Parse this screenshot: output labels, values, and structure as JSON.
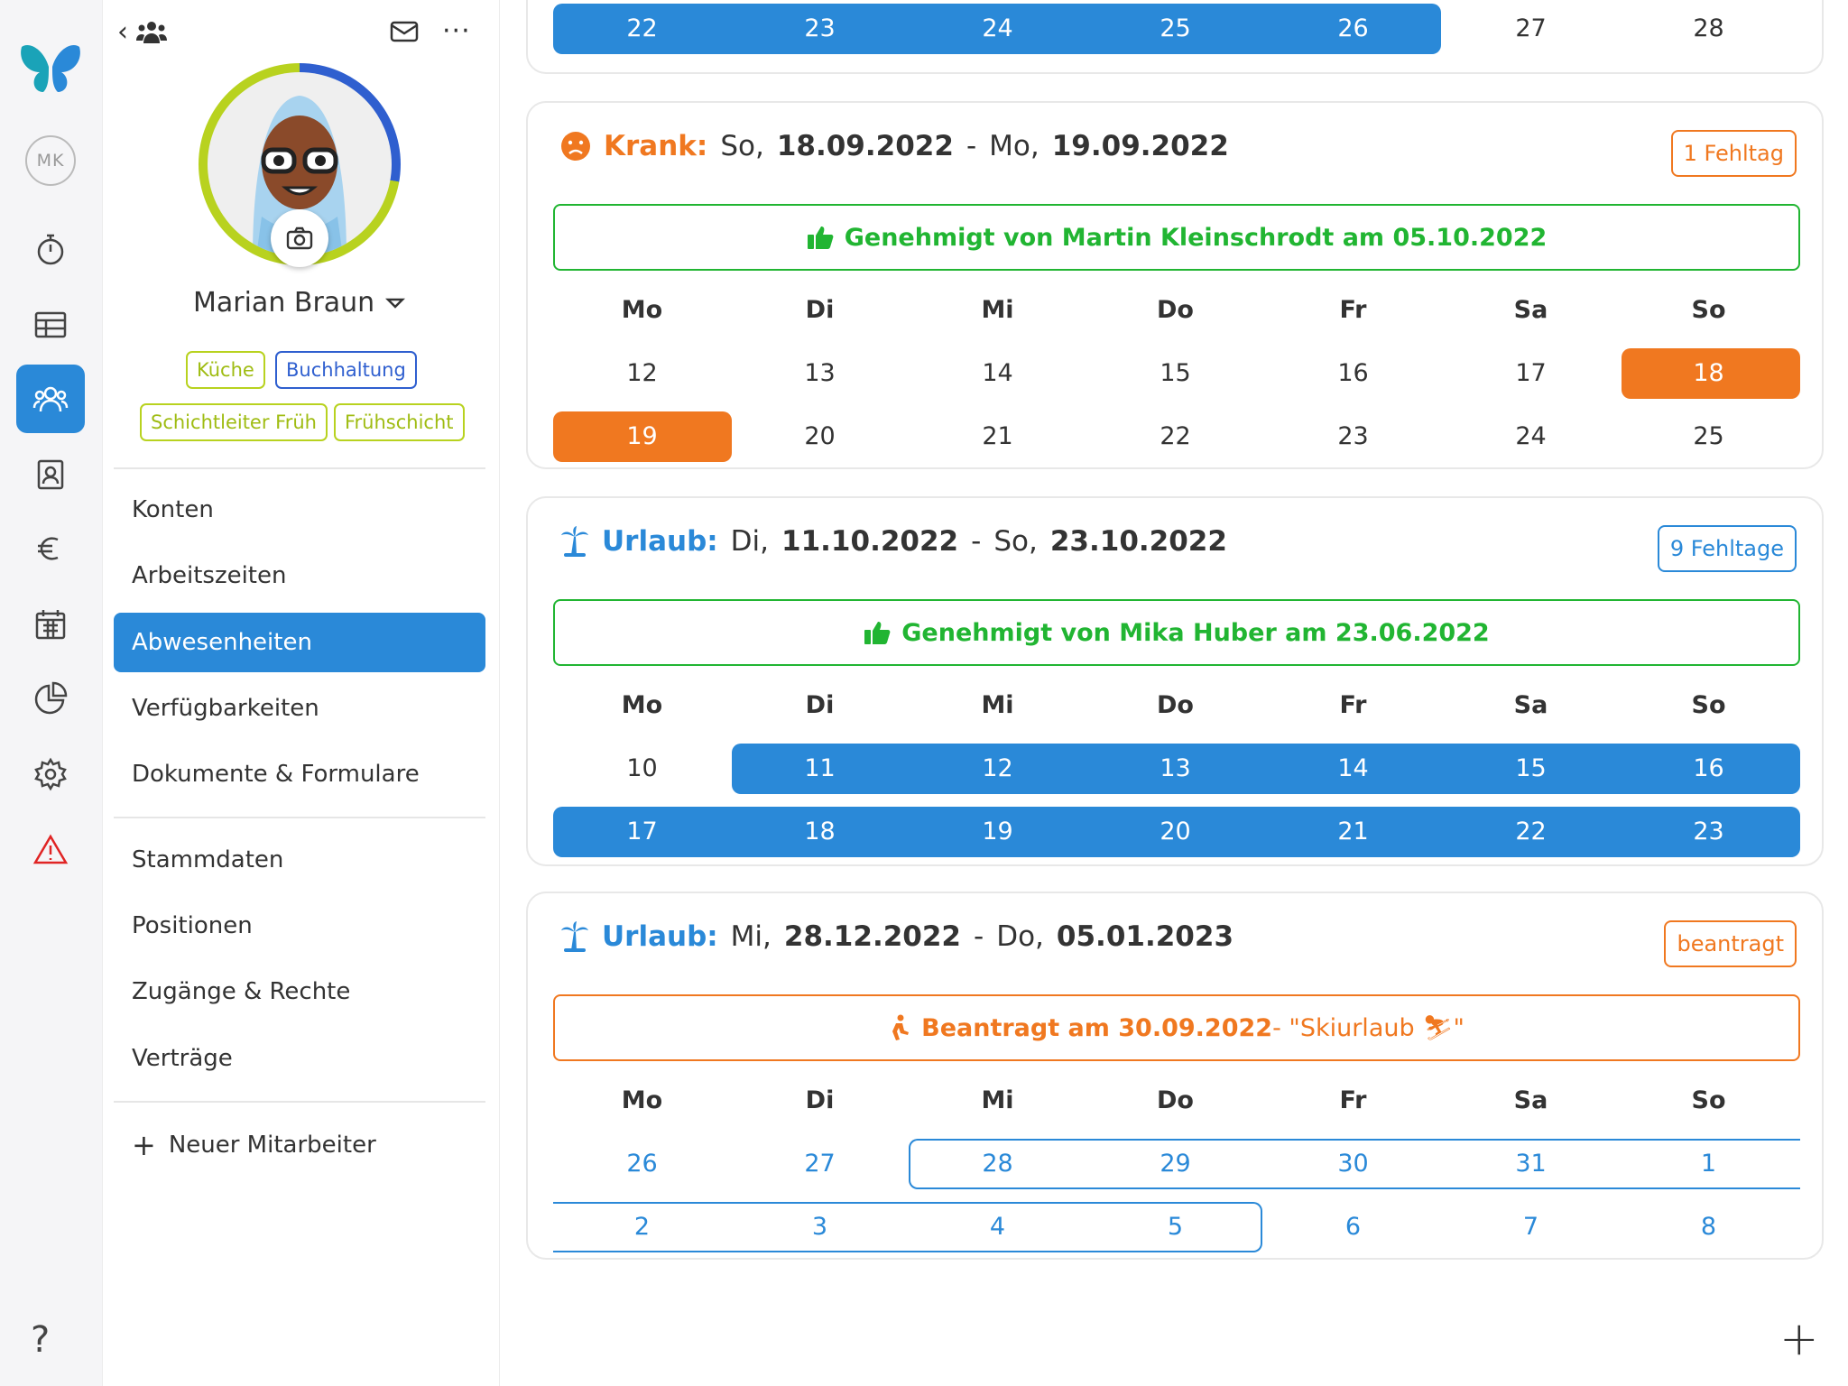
{
  "user": {
    "initials": "MK",
    "name": "Marian Braun",
    "tags": [
      "Küche",
      "Buchhaltung",
      "Schichtleiter Früh",
      "Frühschicht"
    ]
  },
  "menu": {
    "group1": [
      "Konten",
      "Arbeitszeiten",
      "Abwesenheiten",
      "Verfügbarkeiten",
      "Dokumente & Formulare"
    ],
    "group2": [
      "Stammdaten",
      "Positionen",
      "Zugänge & Rechte",
      "Verträge"
    ],
    "new_employee": "Neuer Mitarbeiter",
    "active": "Abwesenheiten"
  },
  "weekdays": [
    "Mo",
    "Di",
    "Mi",
    "Do",
    "Fr",
    "Sa",
    "So"
  ],
  "top_partial_row": [
    "22",
    "23",
    "24",
    "25",
    "26",
    "27",
    "28"
  ],
  "absences": [
    {
      "type": "Krank:",
      "start_day": "So,",
      "start_date": "18.09.2022",
      "end_day": "Mo,",
      "end_date": "19.09.2022",
      "badge": "1 Fehltag",
      "status": "Genehmigt von Martin Kleinschrodt am 05.10.2022",
      "rows": [
        [
          "12",
          "13",
          "14",
          "15",
          "16",
          "17",
          "18"
        ],
        [
          "19",
          "20",
          "21",
          "22",
          "23",
          "24",
          "25"
        ]
      ]
    },
    {
      "type": "Urlaub:",
      "start_day": "Di,",
      "start_date": "11.10.2022",
      "end_day": "So,",
      "end_date": "23.10.2022",
      "badge": "9 Fehltage",
      "status": "Genehmigt von Mika Huber am 23.06.2022",
      "rows": [
        [
          "10",
          "11",
          "12",
          "13",
          "14",
          "15",
          "16"
        ],
        [
          "17",
          "18",
          "19",
          "20",
          "21",
          "22",
          "23"
        ]
      ]
    },
    {
      "type": "Urlaub:",
      "start_day": "Mi,",
      "start_date": "28.12.2022",
      "end_day": "Do,",
      "end_date": "05.01.2023",
      "badge": "beantragt",
      "status_bold": "Beantragt am 30.09.2022",
      "status_note": " - \"Skiurlaub ⛷\"",
      "rows": [
        [
          "26",
          "27",
          "28",
          "29",
          "30",
          "31",
          "1"
        ],
        [
          "2",
          "3",
          "4",
          "5",
          "6",
          "7",
          "8"
        ]
      ]
    }
  ],
  "colors": {
    "primary": "#2a89d8",
    "orange": "#f07820",
    "green": "#21b532",
    "lime": "#b8d21f"
  }
}
